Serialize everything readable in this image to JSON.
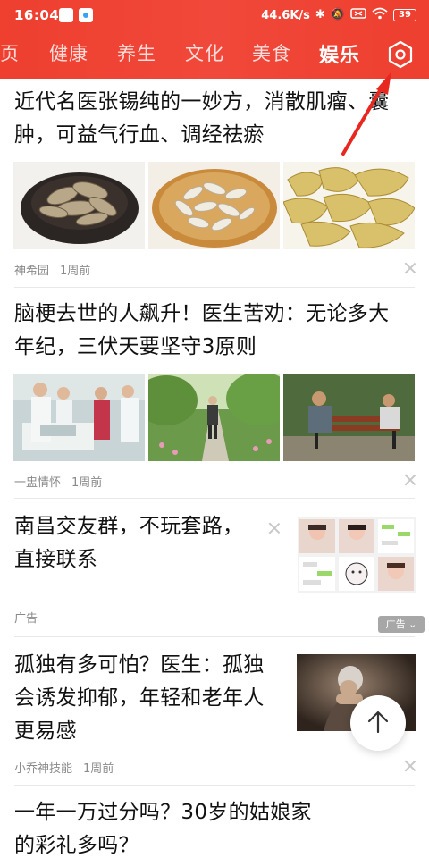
{
  "status_bar": {
    "time": "16:04",
    "network_speed": "44.6K/s",
    "battery": "39",
    "icons": [
      "app-icon",
      "app-icon",
      "bluetooth-icon",
      "mute-icon",
      "sim-icon",
      "wifi-icon",
      "battery-icon"
    ]
  },
  "tabs": [
    {
      "label": "页",
      "active": false
    },
    {
      "label": "健康",
      "active": false
    },
    {
      "label": "养生",
      "active": false
    },
    {
      "label": "文化",
      "active": false
    },
    {
      "label": "美食",
      "active": false
    },
    {
      "label": "娱乐",
      "active": true
    }
  ],
  "settings_icon": "settings-hexagon-icon",
  "feed": {
    "articles": [
      {
        "title_lines": [
          "近代名医张锡纯的一妙方，消散肌瘤、囊",
          "肿，可益气行血、调经祛瘀"
        ],
        "images": [
          "herbal-slices-bowl-image",
          "herbal-slices-plate-image",
          "dried-herb-pieces-image"
        ],
        "source": "神希园",
        "time": "1周前"
      },
      {
        "title_lines": [
          "脑梗去世的人飙升！医生苦劝：无论多大",
          "年纪，三伏天要坚守3原则"
        ],
        "images": [
          "hospital-ward-image",
          "elderly-walking-path-image",
          "elderly-on-bench-image"
        ],
        "source": "一盅情怀",
        "time": "1周前"
      },
      {
        "title_lines": [
          "孤独有多可怕？医生：孤独",
          "会诱发抑郁，年轻和老年人",
          "更易感"
        ],
        "image": "lonely-elderly-woman-image",
        "source": "小乔神技能",
        "time": "1周前"
      },
      {
        "title_lines": [
          "一年一万过分吗？30岁的姑娘家",
          "的彩礼多吗？"
        ]
      }
    ],
    "ad": {
      "title_lines": [
        "南昌交友群，不玩套路，",
        "直接联系"
      ],
      "image": "chat-screenshots-collage-image",
      "label": "广告",
      "badge": "广告"
    }
  },
  "back_to_top_icon": "arrow-up-icon",
  "colors": {
    "brand_red": "#ee3f2f",
    "annotation_red": "#e8281e",
    "meta_gray": "#8a8a8a"
  }
}
